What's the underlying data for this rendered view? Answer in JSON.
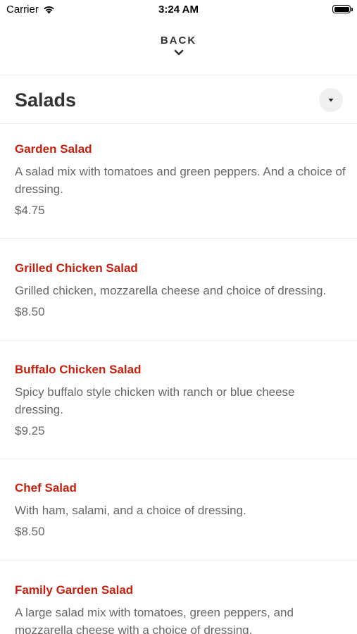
{
  "status_bar": {
    "carrier": "Carrier",
    "time": "3:24 AM"
  },
  "nav": {
    "back_label": "BACK"
  },
  "section": {
    "title": "Salads"
  },
  "items": [
    {
      "name": "Garden Salad",
      "description": "A salad mix with tomatoes and green peppers. And a choice of dressing.",
      "price": "$4.75"
    },
    {
      "name": "Grilled Chicken Salad",
      "description": "Grilled chicken, mozzarella cheese and choice of dressing.",
      "price": "$8.50"
    },
    {
      "name": "Buffalo Chicken Salad",
      "description": "Spicy buffalo style chicken with ranch or blue cheese dressing.",
      "price": "$9.25"
    },
    {
      "name": "Chef Salad",
      "description": "With ham, salami, and a choice of dressing.",
      "price": "$8.50"
    },
    {
      "name": "Family Garden Salad",
      "description": "A large salad mix with tomatoes, green peppers, and mozzarella cheese with a choice of dressing.",
      "price": ""
    }
  ],
  "colors": {
    "item_name": "#c8200f",
    "text_muted": "#666666",
    "title": "#333333"
  }
}
